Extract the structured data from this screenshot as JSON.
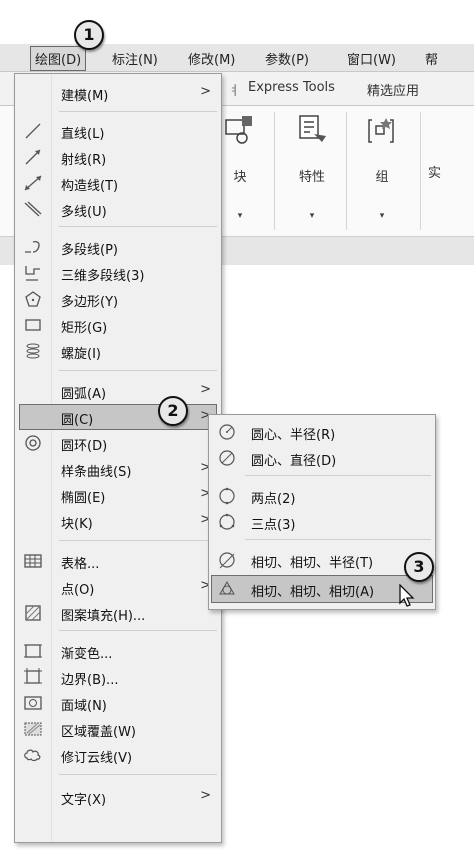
{
  "menubar": {
    "items": [
      "绘图(D)",
      "标注(N)",
      "修改(M)",
      "参数(P)",
      "窗口(W)",
      "帮"
    ]
  },
  "ribbon": {
    "tabs": [
      "Express Tools",
      "精选应用"
    ],
    "tools": [
      {
        "label": "块",
        "icon": "block-icon"
      },
      {
        "label": "特性",
        "icon": "properties-icon"
      },
      {
        "label": "组",
        "icon": "group-icon"
      },
      {
        "label": "实",
        "icon": "utility-icon"
      }
    ]
  },
  "draw_menu": {
    "items": [
      {
        "label": "建模(M)",
        "icon": "",
        "submenu": true
      },
      {
        "label": "直线(L)",
        "icon": "line-icon",
        "submenu": false
      },
      {
        "label": "射线(R)",
        "icon": "ray-icon",
        "submenu": false
      },
      {
        "label": "构造线(T)",
        "icon": "construction-line-icon",
        "submenu": false
      },
      {
        "label": "多线(U)",
        "icon": "multiline-icon",
        "submenu": false
      },
      {
        "label": "多段线(P)",
        "icon": "polyline-icon",
        "submenu": false
      },
      {
        "label": "三维多段线(3)",
        "icon": "3d-polyline-icon",
        "submenu": false
      },
      {
        "label": "多边形(Y)",
        "icon": "polygon-icon",
        "submenu": false
      },
      {
        "label": "矩形(G)",
        "icon": "rectangle-icon",
        "submenu": false
      },
      {
        "label": "螺旋(I)",
        "icon": "helix-icon",
        "submenu": false
      },
      {
        "label": "圆弧(A)",
        "icon": "",
        "submenu": true
      },
      {
        "label": "圆(C)",
        "icon": "",
        "submenu": true
      },
      {
        "label": "圆环(D)",
        "icon": "donut-icon",
        "submenu": false
      },
      {
        "label": "样条曲线(S)",
        "icon": "",
        "submenu": true
      },
      {
        "label": "椭圆(E)",
        "icon": "",
        "submenu": true
      },
      {
        "label": "块(K)",
        "icon": "",
        "submenu": true
      },
      {
        "label": "表格...",
        "icon": "table-icon",
        "submenu": false
      },
      {
        "label": "点(O)",
        "icon": "",
        "submenu": true
      },
      {
        "label": "图案填充(H)...",
        "icon": "hatch-icon",
        "submenu": false
      },
      {
        "label": "渐变色...",
        "icon": "gradient-icon",
        "submenu": false
      },
      {
        "label": "边界(B)...",
        "icon": "boundary-icon",
        "submenu": false
      },
      {
        "label": "面域(N)",
        "icon": "region-icon",
        "submenu": false
      },
      {
        "label": "区域覆盖(W)",
        "icon": "wipeout-icon",
        "submenu": false
      },
      {
        "label": "修订云线(V)",
        "icon": "revcloud-icon",
        "submenu": false
      },
      {
        "label": "文字(X)",
        "icon": "",
        "submenu": true
      }
    ],
    "highlighted": "圆(C)"
  },
  "circle_submenu": {
    "items": [
      {
        "label": "圆心、半径(R)",
        "icon": "circle-center-radius-icon"
      },
      {
        "label": "圆心、直径(D)",
        "icon": "circle-center-diameter-icon"
      },
      {
        "label": "两点(2)",
        "icon": "circle-2point-icon"
      },
      {
        "label": "三点(3)",
        "icon": "circle-3point-icon"
      },
      {
        "label": "相切、相切、半径(T)",
        "icon": "circle-ttr-icon"
      },
      {
        "label": "相切、相切、相切(A)",
        "icon": "circle-ttt-icon"
      }
    ],
    "highlighted": "相切、相切、相切(A)"
  },
  "callouts": [
    "1",
    "2",
    "3"
  ],
  "arrow": ">",
  "dropdown": "▾",
  "colors": {
    "menu_bg": "#f0f0f0",
    "highlight": "#c6c6c6",
    "menubar_bg": "#e6e6e6"
  }
}
